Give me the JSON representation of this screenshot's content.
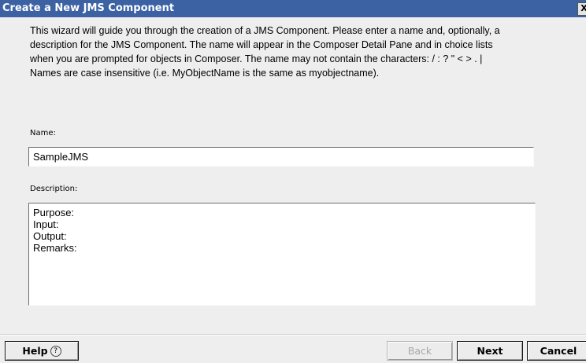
{
  "window": {
    "title": "Create a New JMS Component",
    "close_glyph": "X"
  },
  "intro": {
    "lines": [
      "This wizard will guide you through the creation of a JMS Component.  Please enter a name and, optionally, a",
      "description for the JMS Component.  The name will appear in the Composer Detail Pane and in choice lists",
      "when you are prompted for objects in Composer.  The name may not contain the characters:  / : ? \" < > . |",
      "Names are case insensitive (i.e. MyObjectName is the same as myobjectname)."
    ]
  },
  "form": {
    "name_label": "Name:",
    "name_value": "SampleJMS",
    "description_label": "Description:",
    "description_lines": [
      "Purpose:",
      "Input:",
      "Output:",
      "Remarks:"
    ]
  },
  "buttons": {
    "help_label": "Help",
    "help_icon": "?",
    "back_label": "Back",
    "next_label": "Next",
    "cancel_label": "Cancel"
  },
  "colors": {
    "titlebar": "#3c62a3",
    "window_bg": "#eeeeee"
  }
}
